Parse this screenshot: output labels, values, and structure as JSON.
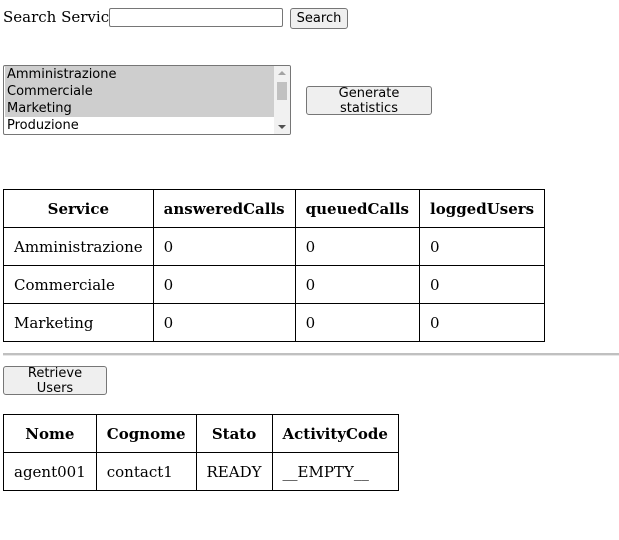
{
  "search": {
    "label": "Search Services",
    "value": "",
    "button_label": "Search"
  },
  "services": {
    "options": [
      {
        "label": "Amministrazione",
        "selected": true
      },
      {
        "label": "Commerciale",
        "selected": true
      },
      {
        "label": "Marketing",
        "selected": true
      },
      {
        "label": "Produzione",
        "selected": false
      }
    ]
  },
  "generate_button_label": "Generate statistics",
  "stats_table": {
    "headers": [
      "Service",
      "answeredCalls",
      "queuedCalls",
      "loggedUsers"
    ],
    "rows": [
      [
        "Amministrazione",
        "0",
        "0",
        "0"
      ],
      [
        "Commerciale",
        "0",
        "0",
        "0"
      ],
      [
        "Marketing",
        "0",
        "0",
        "0"
      ]
    ]
  },
  "retrieve_button_label": "Retrieve Users",
  "users_table": {
    "headers": [
      "Nome",
      "Cognome",
      "Stato",
      "ActivityCode"
    ],
    "rows": [
      [
        "agent001",
        "contact1",
        "READY",
        "__EMPTY__"
      ]
    ]
  },
  "colors": {
    "selected_option": "#cecece",
    "button_bg": "#efefef",
    "border": "#767676"
  }
}
